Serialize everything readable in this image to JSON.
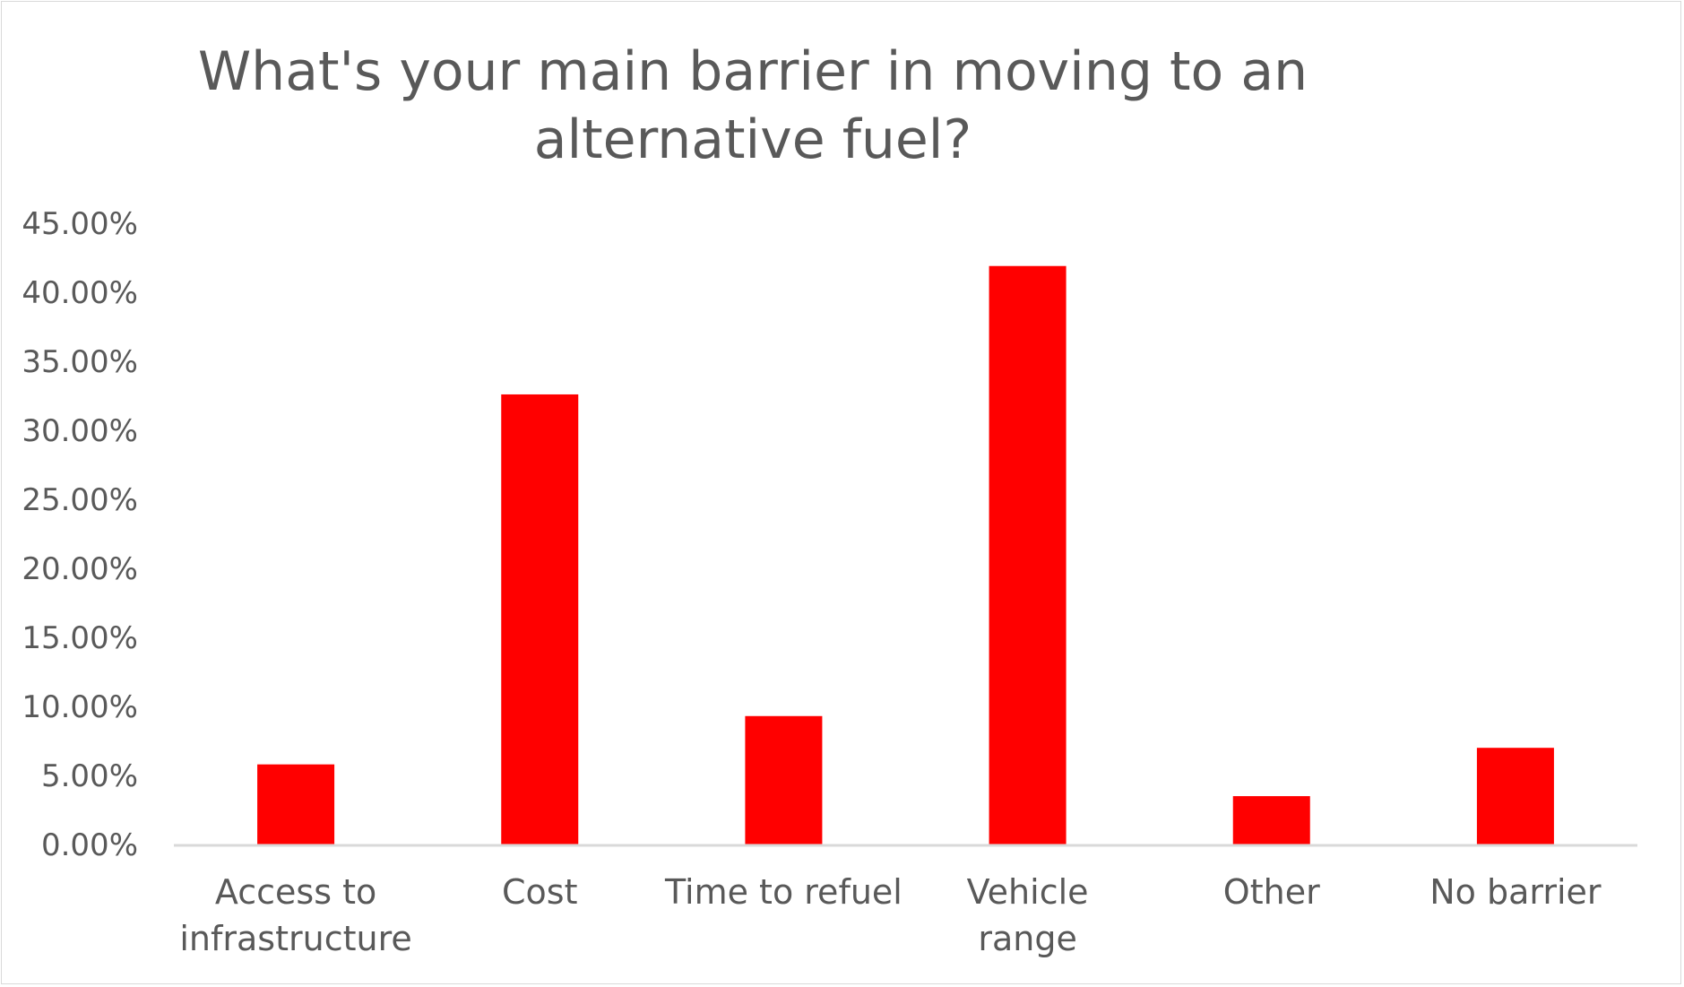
{
  "chart_data": {
    "type": "bar",
    "title": "What's your main barrier in moving to an alternative fuel?",
    "title_lines": [
      "What's your main barrier in moving to an",
      "alternative fuel?"
    ],
    "categories": [
      "Access to infrastructure",
      "Cost",
      "Time to refuel",
      "Vehicle range",
      "Other",
      "No barrier"
    ],
    "category_lines": [
      [
        "Access to",
        "infrastructure"
      ],
      [
        "Cost"
      ],
      [
        "Time to refuel"
      ],
      [
        "Vehicle",
        "range"
      ],
      [
        "Other"
      ],
      [
        "No barrier"
      ]
    ],
    "values": [
      5.8,
      32.6,
      9.3,
      41.9,
      3.5,
      7.0
    ],
    "unit": "%",
    "ylim": [
      0,
      45
    ],
    "yticks": [
      0,
      5,
      10,
      15,
      20,
      25,
      30,
      35,
      40,
      45
    ],
    "ytick_labels": [
      "0.00%",
      "5.00%",
      "10.00%",
      "15.00%",
      "20.00%",
      "25.00%",
      "30.00%",
      "35.00%",
      "40.00%",
      "45.00%"
    ],
    "xlabel": "",
    "ylabel": "",
    "grid": false,
    "legend": "none",
    "bar_color": "#ff0000"
  }
}
